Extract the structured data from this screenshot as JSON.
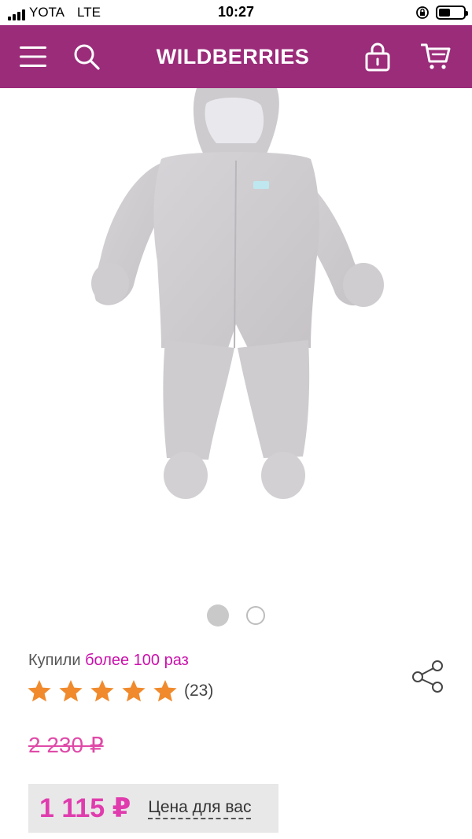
{
  "status_bar": {
    "carrier": "YOTA",
    "network": "LTE",
    "time": "10:27",
    "battery_level": 0.45
  },
  "header": {
    "logo": "WILDBERRIES",
    "icons": [
      "menu-icon",
      "search-icon",
      "bag-lock-icon",
      "cart-icon"
    ],
    "background_color": "#9b2c7a"
  },
  "gallery": {
    "page_count": 2,
    "current_page": 1
  },
  "product": {
    "bought_prefix": "Купили",
    "bought_accent": "более 100 раз",
    "rating": 5,
    "rating_count": "(23)",
    "old_price": "2 230 ₽",
    "price": "1 115 ₽",
    "price_label": "Цена для вас",
    "accent_color": "#cb11ab",
    "star_color": "#f08a2c"
  }
}
